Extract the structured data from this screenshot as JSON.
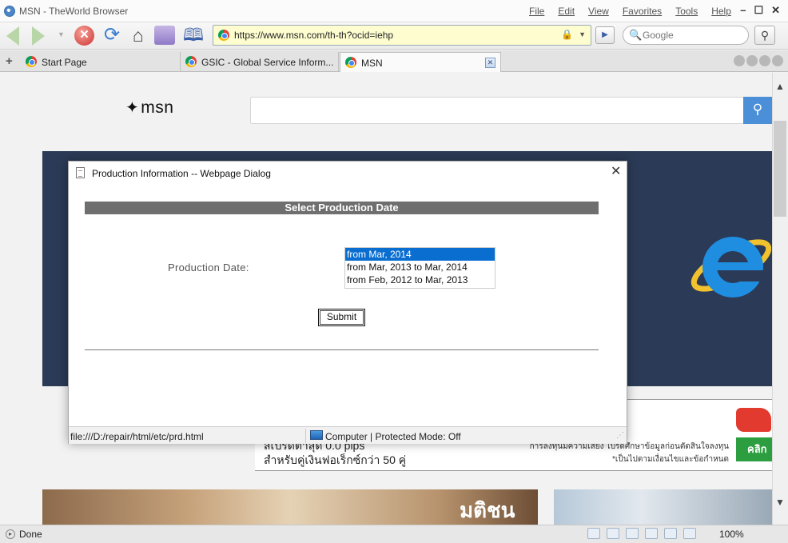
{
  "window": {
    "title": "MSN - TheWorld Browser",
    "menu": [
      "File",
      "Edit",
      "View",
      "Favorites",
      "Tools",
      "Help"
    ],
    "controls": [
      "–",
      "☐",
      "✕"
    ]
  },
  "toolbar": {
    "url": "https://www.msn.com/th-th?ocid=iehp",
    "search_placeholder": "Google"
  },
  "tabs": [
    {
      "label": "Start Page"
    },
    {
      "label": "GSIC - Global Service Inform..."
    },
    {
      "label": "MSN"
    }
  ],
  "msn": {
    "logo_text": "msn",
    "ad": {
      "line1": "สเปรดต่ำสุด 0.0 pips",
      "line2": "สำหรับคู่เงินฟอเร็กซ์กว่า 50 คู่",
      "disclaimer1": "การลงทุนมีความเสี่ยง โปรดศึกษาข้อมูลก่อนตัดสินใจลงทุน",
      "disclaimer2": "*เป็นไปตามเงื่อนไขและข้อกำหนด",
      "cta": "คลิก"
    },
    "thumb_text": "มติชน"
  },
  "dialog": {
    "title": "Production Information -- Webpage Dialog",
    "header": "Select Production Date",
    "label": "Production Date:",
    "options": [
      "from Mar, 2014",
      "from Mar, 2013 to Mar, 2014",
      "from Feb, 2012 to Mar, 2013"
    ],
    "selected_index": 0,
    "submit": "Submit",
    "status_left": "file:///D:/repair/html/etc/prd.html",
    "status_right": "Computer | Protected Mode: Off"
  },
  "statusbar": {
    "text": "Done",
    "zoom": "100%"
  },
  "colors": {
    "selection": "#0a6ed1",
    "header_bar": "#6f6f6f",
    "hero_bg": "#2b3a56",
    "address_bg": "#fdfdd0"
  }
}
